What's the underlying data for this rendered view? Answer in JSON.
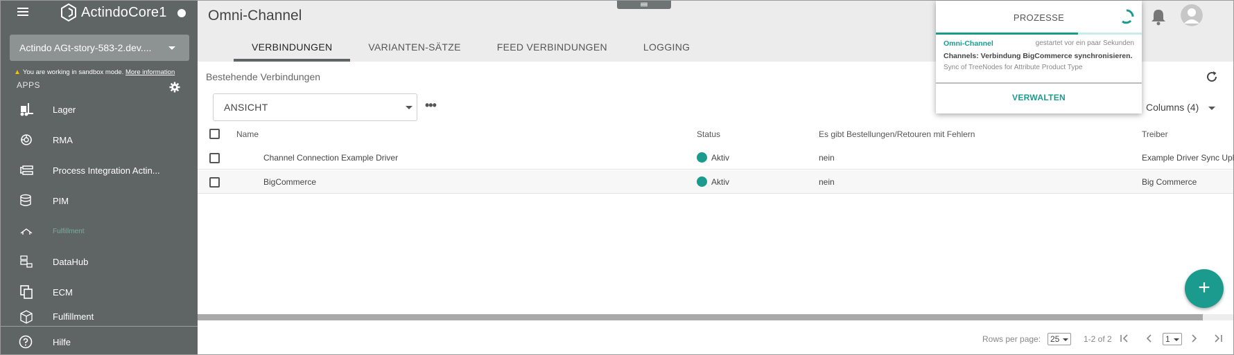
{
  "app": {
    "logo_text": "ActindoCore1",
    "environment": "Actindo AGt-story-583-2.dev....",
    "sandbox_notice": "You are working in sandbox mode.",
    "sandbox_link": "More information"
  },
  "sidebar": {
    "apps_label": "APPS",
    "items": [
      {
        "label": "Lager",
        "icon": "forklift-icon"
      },
      {
        "label": "RMA",
        "icon": "rma-icon"
      },
      {
        "label": "Process Integration Actin...",
        "icon": "process-integration-icon"
      },
      {
        "label": "PIM",
        "icon": "pim-icon"
      },
      {
        "label": "Fulfillment",
        "icon": "fulfillment-icon"
      },
      {
        "label": "DataHub",
        "icon": "datahub-icon"
      },
      {
        "label": "ECM",
        "icon": "ecm-icon"
      },
      {
        "label": "Fulfillment",
        "icon": "fulfillment-box-icon"
      }
    ],
    "help_label": "Hilfe"
  },
  "header": {
    "page_title": "Omni-Channel",
    "tabs": [
      {
        "label": "VERBINDUNGEN",
        "active": true
      },
      {
        "label": "VARIANTEN-SÄTZE",
        "active": false
      },
      {
        "label": "FEED VERBINDUNGEN",
        "active": false
      },
      {
        "label": "LOGGING",
        "active": false
      }
    ]
  },
  "content": {
    "section_title": "Bestehende Verbindungen",
    "view_select": "ANSICHT",
    "more_label": "•••",
    "columns_label": "Columns (4)",
    "table": {
      "headers": [
        "Name",
        "Status",
        "Es gibt Bestellungen/Retouren mit Fehlern",
        "Treiber"
      ],
      "rows": [
        {
          "name": "Channel Connection Example Driver",
          "status": "Aktiv",
          "errors": "nein",
          "driver": "Example Driver Sync Uplo"
        },
        {
          "name": "BigCommerce",
          "status": "Aktiv",
          "errors": "nein",
          "driver": "Big Commerce"
        }
      ]
    },
    "fab_label": "+"
  },
  "pagination": {
    "rows_per_page_label": "Rows per page:",
    "rows_per_page_value": "25",
    "range": "1-2 of 2",
    "page_value": "1"
  },
  "processes": {
    "title": "PROZESSE",
    "app": "Omni-Channel",
    "started": "gestartet vor ein paar Sekunden",
    "task": "Channels: Verbindung BigCommerce synchronisieren.",
    "subtask": "Sync of TreeNodes for Attribute Product Type",
    "progress": 0.69,
    "manage_label": "VERWALTEN"
  },
  "colors": {
    "sidebar": "#5f6565",
    "accent": "#1a9b8d",
    "header": "#ececec"
  }
}
